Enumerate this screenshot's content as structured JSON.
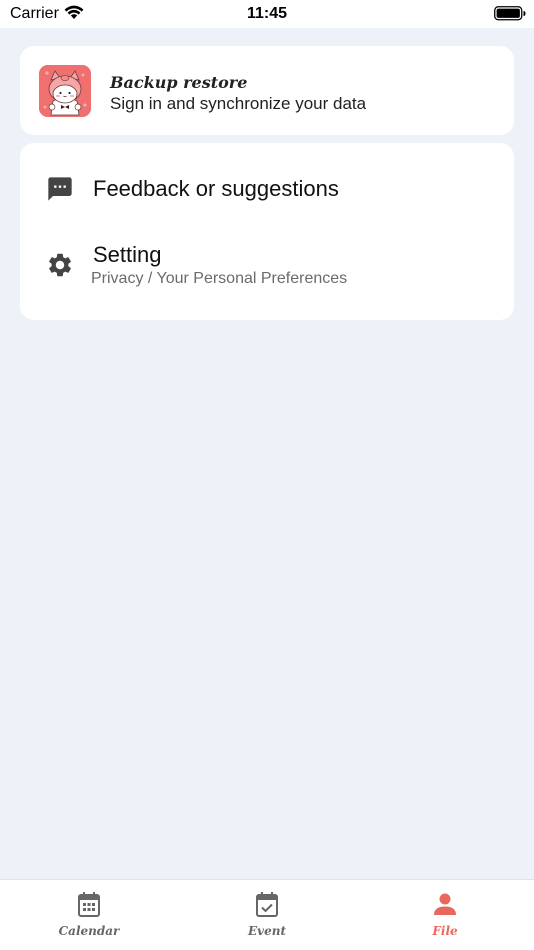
{
  "status_bar": {
    "carrier": "Carrier",
    "time": "11:45"
  },
  "backup": {
    "title": "Backup restore",
    "subtitle": "Sign in and synchronize your data",
    "avatar_icon": "pig-mascot-avatar"
  },
  "menu": {
    "feedback": {
      "title": "Feedback or suggestions",
      "icon": "chat-bubble-icon"
    },
    "setting": {
      "title": "Setting",
      "subtitle": "Privacy / Your Personal Preferences",
      "icon": "gear-icon"
    }
  },
  "tabbar": {
    "tabs": [
      {
        "label": "Calendar",
        "icon": "calendar-grid-icon",
        "active": false
      },
      {
        "label": "Event",
        "icon": "calendar-check-icon",
        "active": false
      },
      {
        "label": "File",
        "icon": "person-icon",
        "active": true
      }
    ]
  },
  "colors": {
    "background": "#edf1f8",
    "card": "#ffffff",
    "accent": "#e9685d",
    "icon_gray": "#444444",
    "tab_inactive": "#666666"
  }
}
